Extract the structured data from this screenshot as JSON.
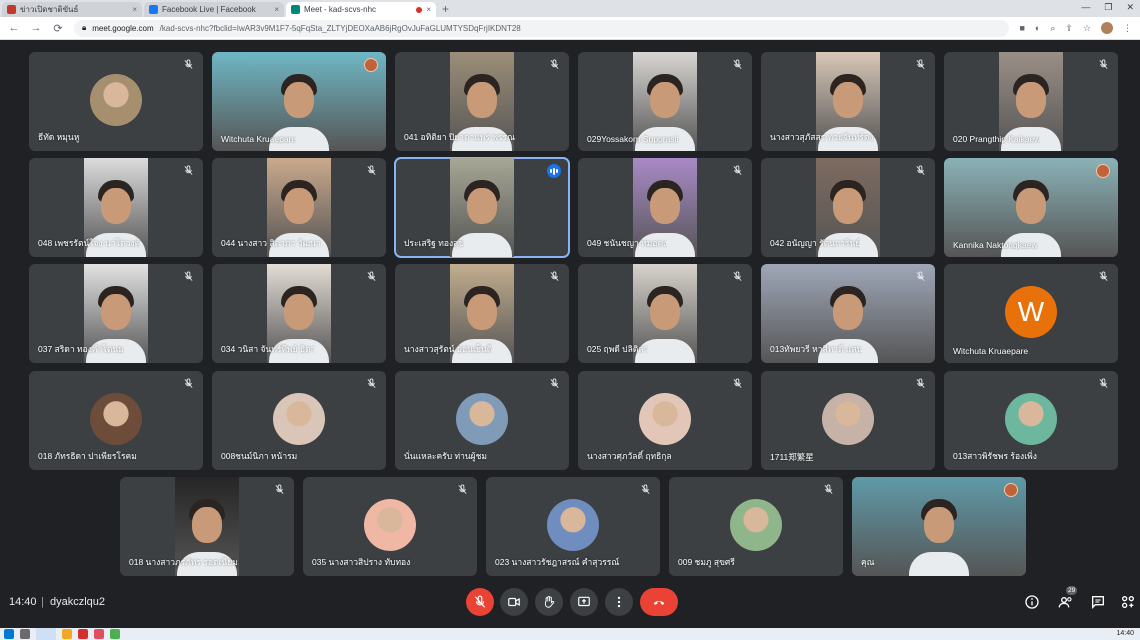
{
  "browser": {
    "tabs": [
      {
        "title": "ข่าวเปิดชาติขันธ์",
        "favicon_color": "#c0392b"
      },
      {
        "title": "Facebook Live | Facebook",
        "favicon_color": "#1877f2"
      },
      {
        "title": "Meet - kad-scvs-nhc",
        "favicon_color": "#00897b",
        "active": true,
        "recording": true
      }
    ],
    "url_host": "meet.google.com",
    "url_path": "/kad-scvs-nhc?fbclid=IwAR3v9M1F7-5qFqSta_ZLTYjDEOXaAB6jRgOvJuFaGLUMTYSDqFrjIKDNT28",
    "new_tab_glyph": "+",
    "close_glyph": "×"
  },
  "participants": [
    {
      "name": "ธีทัด หมุนหู",
      "kind": "avatar",
      "color": "#a58f6f"
    },
    {
      "name": "Witchuta Kruaepare",
      "kind": "video-wide",
      "color": "#6fb7c5",
      "badge": true
    },
    {
      "name": "041 อทิติยา ปิยาดาแพร่ พรรณ",
      "kind": "video",
      "color": "#9c8e78"
    },
    {
      "name": "029Yossakorn Supprasit",
      "kind": "video",
      "color": "#d8d6d2"
    },
    {
      "name": "นางสาวสุภัสสร ทวยจันทร์ดง",
      "kind": "video",
      "color": "#d8c7b7"
    },
    {
      "name": "020 Prangthip Kaikaew",
      "kind": "video",
      "color": "#9a8f86"
    },
    {
      "name": "048 เพชรรัตน์ใจง นาโดวงค์",
      "kind": "video",
      "color": "#dcdcdc"
    },
    {
      "name": "044 นางสาว สิตาภา วัฒนา",
      "kind": "video",
      "color": "#c9a98c"
    },
    {
      "name": "ประเสริฐ ทองสุข",
      "kind": "video",
      "color": "#a7a796",
      "speaking": true
    },
    {
      "name": "049 ชนันชญา หมอคง",
      "kind": "video",
      "color": "#a98ac8"
    },
    {
      "name": "042 อนัญญา รัตนการินย์",
      "kind": "video",
      "color": "#7d6b60"
    },
    {
      "name": "Kannika Naktongkaew",
      "kind": "video-wide",
      "color": "#8bb2b8",
      "badge": true
    },
    {
      "name": "037 สริดา ทองคำโตนม",
      "kind": "video",
      "color": "#e2e2e2"
    },
    {
      "name": "034 วนิสา จันทร์ทิพย์ ธิดา",
      "kind": "video",
      "color": "#e4ddd6"
    },
    {
      "name": "นางสาวสุรัตน์ อ่อนเย็นดี",
      "kind": "video",
      "color": "#c2ad8e"
    },
    {
      "name": "025 ฤพดี ปลิติลา",
      "kind": "video",
      "color": "#d7d2cb"
    },
    {
      "name": "013ทัพยวรี หาสีทาดี แสน",
      "kind": "video-wide",
      "color": "#9fa7b8"
    },
    {
      "name": "Witchuta Kruaepare",
      "kind": "letter",
      "letter": "W",
      "color": "#e8710a"
    },
    {
      "name": "018 ภัทรธิดา ปาเพียรโรคม",
      "kind": "avatar",
      "color": "#6d4c3a"
    },
    {
      "name": "008ชนม์นิภา หน้ารม",
      "kind": "avatar",
      "color": "#d9c6b8"
    },
    {
      "name": "นั่นแหละครับ ท่านผู้ชม",
      "kind": "avatar",
      "color": "#7f9bb8"
    },
    {
      "name": "นางสาวศุภวัลดิ์ ฤทธิกุล",
      "kind": "avatar",
      "color": "#e2c7b8"
    },
    {
      "name": "1711郑繁星",
      "kind": "avatar",
      "color": "#c7b2a8"
    },
    {
      "name": "013สาวพิรัชพร ร้องเพิ่ง",
      "kind": "avatar",
      "color": "#6cb79e"
    },
    {
      "name": "018 นางสาวภรภัทร รอดเนียม",
      "kind": "video",
      "color": "#262626"
    },
    {
      "name": "035 นางสาวสิปราง ทับทอง",
      "kind": "avatar",
      "color": "#f0b7a4"
    },
    {
      "name": "023 นางสาวรัชฎาสรณ์ คำสุวรรณ์",
      "kind": "avatar",
      "color": "#6f8dbf"
    },
    {
      "name": "009 ชมภู สุขศรี",
      "kind": "avatar",
      "color": "#8fb58a"
    },
    {
      "name": "คุณ",
      "kind": "video-wide",
      "color": "#5f9aa8",
      "badge": true
    }
  ],
  "bottom": {
    "time": "14:40",
    "separator": "|",
    "meeting_code": "dyakczlqu2",
    "people_count": "29"
  },
  "taskbar": {
    "time": "14:40"
  }
}
